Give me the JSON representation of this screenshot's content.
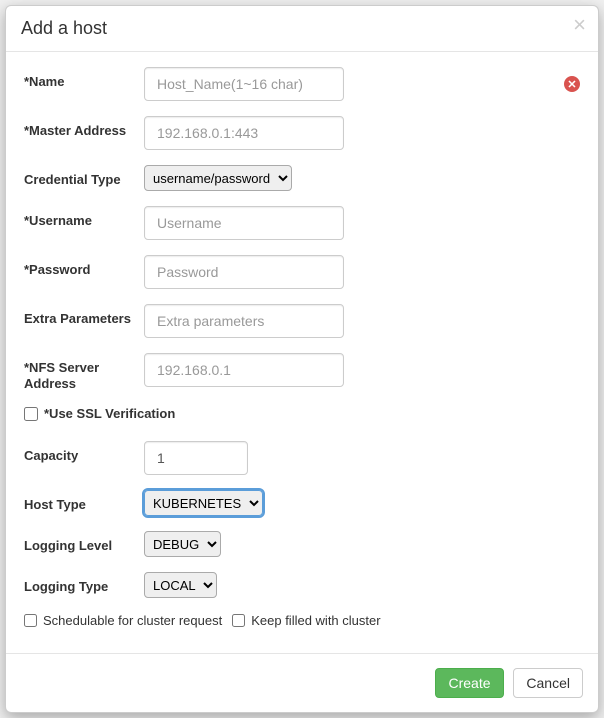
{
  "modal": {
    "title": "Add a host",
    "close_glyph": "×"
  },
  "form": {
    "name": {
      "label": "*Name",
      "placeholder": "Host_Name(1~16 char)",
      "value": "",
      "error_glyph": "✕"
    },
    "master_address": {
      "label": "*Master Address",
      "placeholder": "192.168.0.1:443",
      "value": ""
    },
    "credential_type": {
      "label": "Credential Type",
      "selected": "username/password"
    },
    "username": {
      "label": "*Username",
      "placeholder": "Username",
      "value": ""
    },
    "password": {
      "label": "*Password",
      "placeholder": "Password",
      "value": ""
    },
    "extra_params": {
      "label": "Extra Parameters",
      "placeholder": "Extra parameters",
      "value": ""
    },
    "nfs_server": {
      "label": "*NFS Server Address",
      "placeholder": "192.168.0.1",
      "value": ""
    },
    "ssl_verify": {
      "label": "*Use SSL Verification",
      "checked": false
    },
    "capacity": {
      "label": "Capacity",
      "value": "1"
    },
    "host_type": {
      "label": "Host Type",
      "selected": "KUBERNETES"
    },
    "logging_level": {
      "label": "Logging Level",
      "selected": "DEBUG"
    },
    "logging_type": {
      "label": "Logging Type",
      "selected": "LOCAL"
    },
    "schedulable": {
      "label": "Schedulable for cluster request",
      "checked": false
    },
    "keep_filled": {
      "label": "Keep filled with cluster",
      "checked": false
    }
  },
  "footer": {
    "create_label": "Create",
    "cancel_label": "Cancel"
  }
}
